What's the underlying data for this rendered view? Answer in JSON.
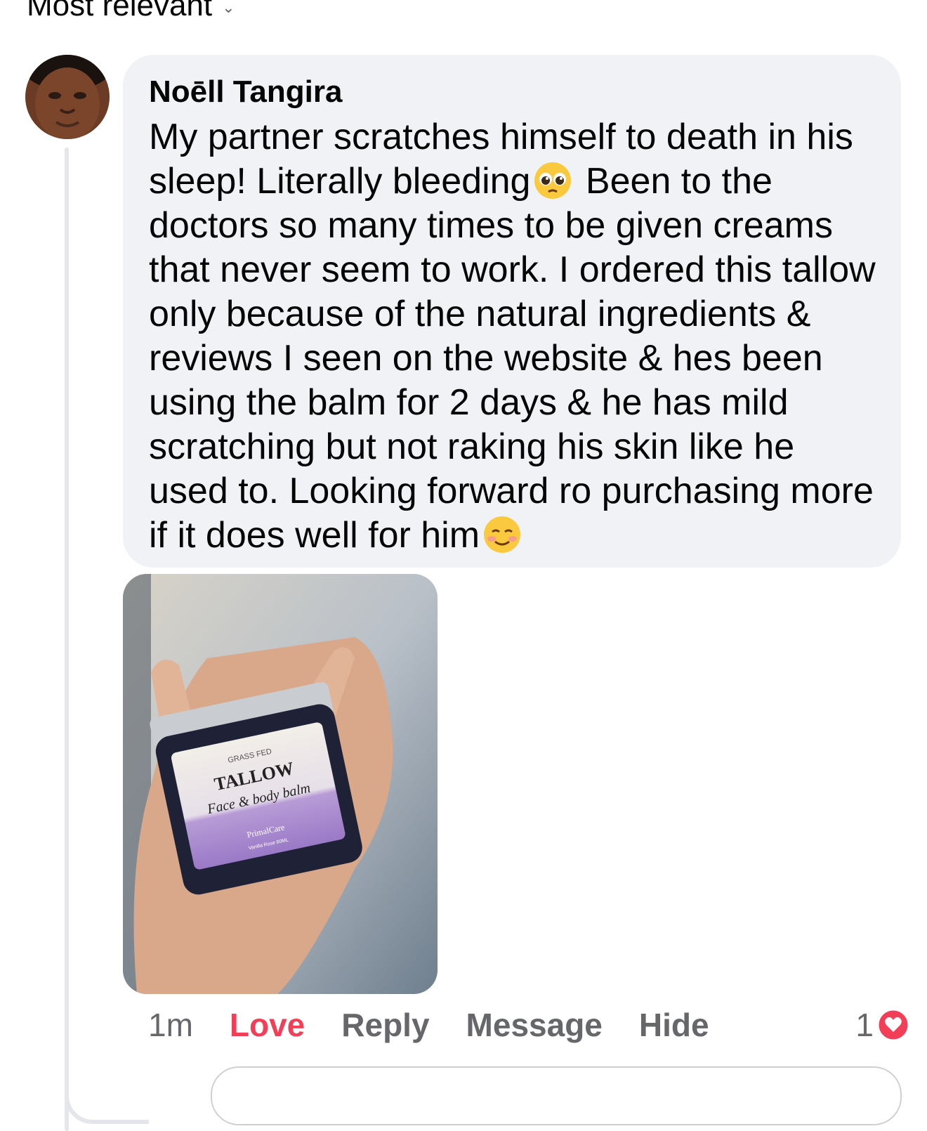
{
  "header": {
    "sort_label": "Most relevant",
    "sort_icon": "chevron-down-icon"
  },
  "comment": {
    "author": "Noēll Tangira",
    "text_part1": "My partner scratches himself to death in his sleep! Literally bleeding",
    "text_part2": " Been to the doctors so many times to be given creams that never seem to work. I ordered this tallow only because of the natural ingredients & reviews I seen on the website & hes been using the balm for 2 days & he has mild scratching but not raking his skin like he used to. Looking forward ro purchasing more if it does well for him",
    "emoji1": "pleading-face-emoji",
    "emoji2": "smiling-face-emoji",
    "photo": {
      "label_top": "GRASS FED",
      "label_title": "TALLOW",
      "label_script": "Face & body balm",
      "label_brand": "PrimalCare",
      "label_variant": "Vanilla Rose 60ML"
    }
  },
  "actions": {
    "time": "1m",
    "love": "Love",
    "reply": "Reply",
    "message": "Message",
    "hide": "Hide",
    "reaction_count": "1",
    "reaction_icon": "heart-icon"
  },
  "colors": {
    "love": "#f33e58",
    "muted": "#65676b",
    "bubble": "#f0f2f5"
  }
}
